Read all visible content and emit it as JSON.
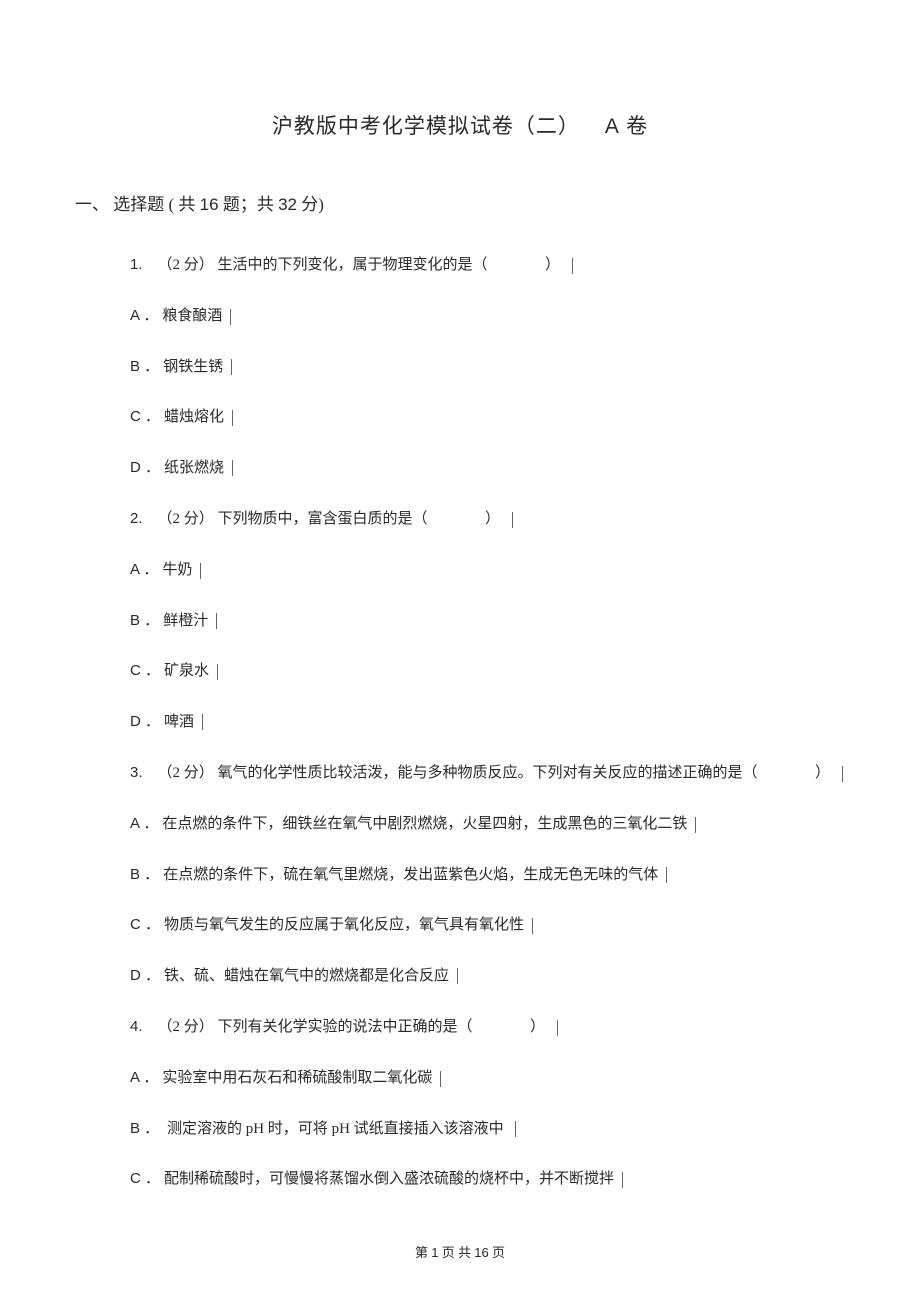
{
  "title": {
    "main": "沪教版中考化学模拟试卷（二）",
    "suffix": "A",
    "suffix_after": "卷"
  },
  "section": {
    "label_prefix": "一、",
    "label_spacer": "  ",
    "label_name": "选择题",
    "count_open": " ( 共 ",
    "count_q": "16",
    "count_mid": " 题；共 ",
    "count_pts": "32",
    "count_close": " 分)"
  },
  "questions": [
    {
      "num": "1.",
      "points": "（2 分）",
      "stem_before": "生活中的下列变化，属于物理变化的是（",
      "stem_after": "）",
      "options": [
        {
          "letter": "A ．",
          "text": "粮食酿酒"
        },
        {
          "letter": "B ．",
          "text": "钢铁生锈"
        },
        {
          "letter": "C ．",
          "text": "蜡烛熔化"
        },
        {
          "letter": "D ．",
          "text": "纸张燃烧"
        }
      ]
    },
    {
      "num": "2.",
      "points": "（2 分）",
      "stem_before": "下列物质中，富含蛋白质的是（",
      "stem_after": "）",
      "options": [
        {
          "letter": "A ．",
          "text": "牛奶"
        },
        {
          "letter": "B ．",
          "text": "鲜橙汁"
        },
        {
          "letter": "C ．",
          "text": "矿泉水"
        },
        {
          "letter": "D ．",
          "text": "啤酒"
        }
      ]
    },
    {
      "num": "3.",
      "points": "（2 分）",
      "stem_before": "氧气的化学性质比较活泼，能与多种物质反应。下列对有关反应的描述正确的是（",
      "stem_after": "）",
      "options": [
        {
          "letter": "A ．",
          "text": "在点燃的条件下，细铁丝在氧气中剧烈燃烧，火星四射，生成黑色的三氧化二铁"
        },
        {
          "letter": "B ．",
          "text": "在点燃的条件下，硫在氧气里燃烧，发出蓝紫色火焰，生成无色无味的气体"
        },
        {
          "letter": "C ．",
          "text": "物质与氧气发生的反应属于氧化反应，氧气具有氧化性"
        },
        {
          "letter": "D ．",
          "text": "铁、硫、蜡烛在氧气中的燃烧都是化合反应"
        }
      ]
    },
    {
      "num": "4.",
      "points": "（2 分）",
      "stem_before": "下列有关化学实验的说法中正确的是（",
      "stem_after": "）",
      "options": [
        {
          "letter": "A ．",
          "text": "实验室中用石灰石和稀硫酸制取二氧化碳"
        },
        {
          "letter": "B ．",
          "text_before": "测定溶液的 ",
          "text_latin": "pH",
          "text_mid": " 时，可将 ",
          "text_latin2": "pH",
          "text_after": " 试纸直接插入该溶液中"
        },
        {
          "letter": "C ．",
          "text": "配制稀硫酸时，可慢慢将蒸馏水倒入盛浓硫酸的烧杯中，并不断搅拌"
        }
      ]
    }
  ],
  "footer": {
    "prefix": "第 ",
    "page": "1",
    "mid": " 页 共 ",
    "total": "16",
    "suffix": " 页"
  }
}
